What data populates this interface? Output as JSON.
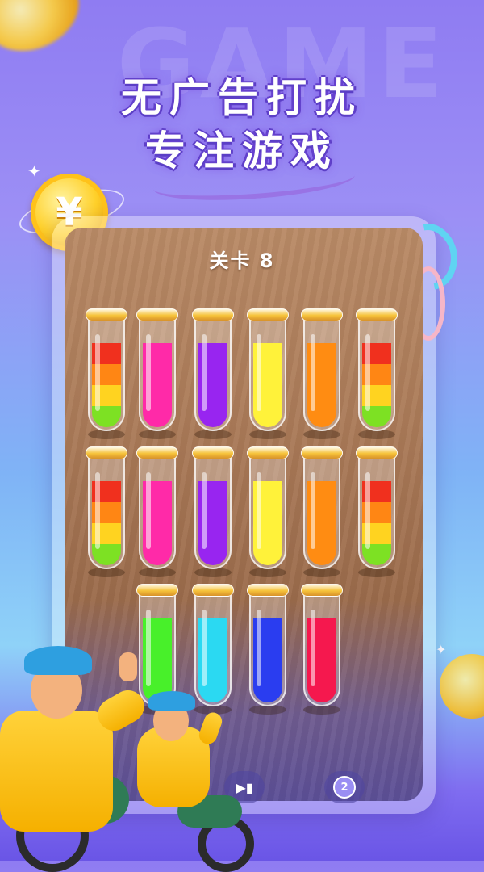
{
  "background_word": "GAME",
  "headline": {
    "line1": "无广告打扰",
    "line2": "专注游戏"
  },
  "coin": {
    "symbol": "¥"
  },
  "game": {
    "level_label": "关卡 8",
    "tubes_row1": [
      {
        "layers": [
          "#7de123",
          "#ffd320",
          "#ff8614",
          "#f0301e"
        ]
      },
      {
        "layers": [
          "#ff2aa8",
          "#ff2aa8",
          "#ff2aa8",
          "#ff2aa8"
        ]
      },
      {
        "layers": [
          "#9825f0",
          "#9825f0",
          "#9825f0",
          "#9825f0"
        ]
      },
      {
        "layers": [
          "#fff23a",
          "#fff23a",
          "#fff23a",
          "#fff23a"
        ]
      },
      {
        "layers": [
          "#ff8c12",
          "#ff8c12",
          "#ff8c12",
          "#ff8c12"
        ]
      },
      {
        "layers": [
          "#7de123",
          "#ffd320",
          "#ff8614",
          "#f0301e"
        ]
      }
    ],
    "tubes_row2": [
      {
        "layers": [
          "#7de123",
          "#ffd320",
          "#ff8614",
          "#f0301e"
        ]
      },
      {
        "layers": [
          "#ff2aa8",
          "#ff2aa8",
          "#ff2aa8",
          "#ff2aa8"
        ]
      },
      {
        "layers": [
          "#9825f0",
          "#9825f0",
          "#9825f0",
          "#9825f0"
        ]
      },
      {
        "layers": [
          "#fff23a",
          "#fff23a",
          "#fff23a",
          "#fff23a"
        ]
      },
      {
        "layers": [
          "#ff8c12",
          "#ff8c12",
          "#ff8c12",
          "#ff8c12"
        ]
      },
      {
        "layers": [
          "#7de123",
          "#ffd320",
          "#ff8614",
          "#f0301e"
        ]
      }
    ],
    "tubes_row3": [
      {
        "layers": [
          "#48f02a",
          "#48f02a",
          "#48f02a",
          "#48f02a"
        ]
      },
      {
        "layers": [
          "#2bd9f2",
          "#2bd9f2",
          "#2bd9f2",
          "#2bd9f2"
        ]
      },
      {
        "layers": [
          "#2a3df0",
          "#2a3df0",
          "#2a3df0",
          "#2a3df0"
        ]
      },
      {
        "layers": [
          "#f5184e",
          "#f5184e",
          "#f5184e",
          "#f5184e"
        ]
      }
    ],
    "controls": {
      "hint_count": "2"
    }
  }
}
